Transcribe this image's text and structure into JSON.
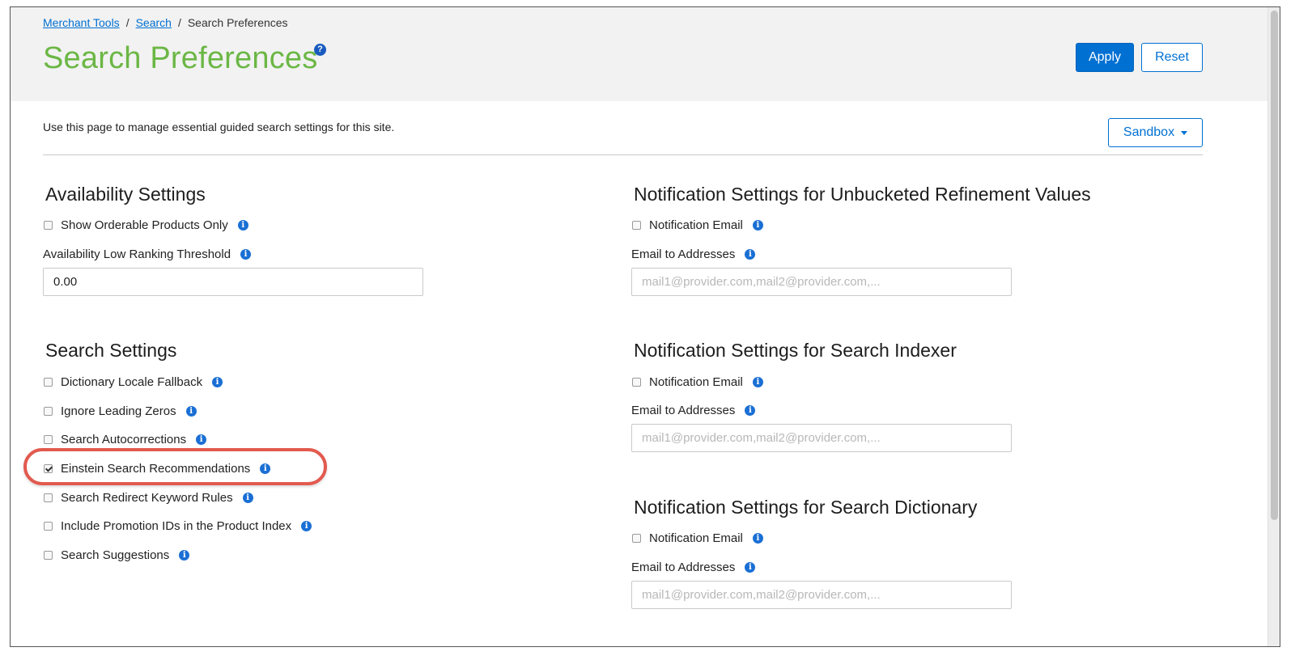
{
  "breadcrumb": {
    "items": [
      "Merchant Tools",
      "Search"
    ],
    "separator": "/",
    "current": "Search Preferences"
  },
  "header": {
    "title": "Search Preferences",
    "help_glyph": "?",
    "apply_label": "Apply",
    "reset_label": "Reset"
  },
  "intro": {
    "text": "Use this page to manage essential guided search settings for this site."
  },
  "environment": {
    "selected": "Sandbox"
  },
  "info_glyph": "i",
  "availability": {
    "title": "Availability Settings",
    "show_orderable_label": "Show Orderable Products Only",
    "show_orderable_checked": false,
    "threshold_label": "Availability Low Ranking Threshold",
    "threshold_value": "0.00"
  },
  "search_settings": {
    "title": "Search Settings",
    "items": [
      {
        "label": "Dictionary Locale Fallback",
        "checked": false
      },
      {
        "label": "Ignore Leading Zeros",
        "checked": false
      },
      {
        "label": "Search Autocorrections",
        "checked": false
      },
      {
        "label": "Einstein Search Recommendations",
        "checked": true
      },
      {
        "label": "Search Redirect Keyword Rules",
        "checked": false
      },
      {
        "label": "Include Promotion IDs in the Product Index",
        "checked": false
      },
      {
        "label": "Search Suggestions",
        "checked": false
      }
    ]
  },
  "notifications": [
    {
      "title": "Notification Settings for Unbucketed Refinement Values",
      "email_label": "Notification Email",
      "addresses_label": "Email to Addresses",
      "addresses_placeholder": "mail1@provider.com,mail2@provider.com,..."
    },
    {
      "title": "Notification Settings for Search Indexer",
      "email_label": "Notification Email",
      "addresses_label": "Email to Addresses",
      "addresses_placeholder": "mail1@provider.com,mail2@provider.com,..."
    },
    {
      "title": "Notification Settings for Search Dictionary",
      "email_label": "Notification Email",
      "addresses_label": "Email to Addresses",
      "addresses_placeholder": "mail1@provider.com,mail2@provider.com,..."
    }
  ],
  "colors": {
    "title_green": "#6bb745",
    "primary_blue": "#0070d2",
    "highlight_red": "#e25a4f"
  }
}
